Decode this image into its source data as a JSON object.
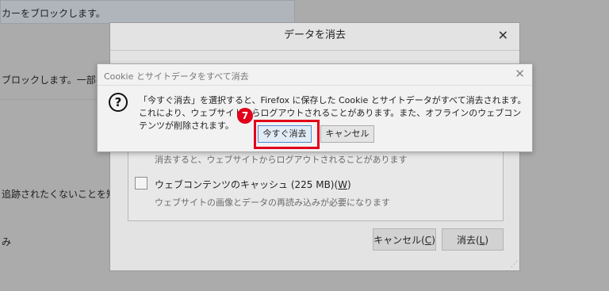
{
  "background": {
    "line1": "カーをブロックします。",
    "line2": "ブロックします。一部のサ",
    "line3": "追跡されたくないことを知ら",
    "line4": "み"
  },
  "main_dialog": {
    "title": "データを消去",
    "close_glyph": "✕",
    "cookie_desc": "消去すると、ウェブサイトからログアウトされることがあります",
    "cache_label": "ウェブコンテンツのキャッシュ (225 MB)(",
    "cache_accesskey": "W",
    "cache_label_end": ")",
    "cache_desc": "ウェブサイトの画像とデータの再読み込みが必要になります",
    "cancel_label": "キャンセル(",
    "cancel_accesskey": "C",
    "clear_label": "消去(",
    "clear_accesskey": "L",
    "paren_close": ")"
  },
  "confirm_dialog": {
    "title": "Cookie とサイトデータをすべて消去",
    "close_glyph": "✕",
    "icon": "question-icon",
    "message": "「今すぐ消去」を選択すると、Firefox に保存した Cookie とサイトデータがすべて消去されます。これにより、ウェブサイトからログアウトされることがあります。また、オフラインのウェブコンテンツが削除されます。",
    "clear_now_label": "今すぐ消去",
    "cancel_label": "キャンセル"
  },
  "annotation": {
    "step_number": "7",
    "color": "#e2001a"
  }
}
